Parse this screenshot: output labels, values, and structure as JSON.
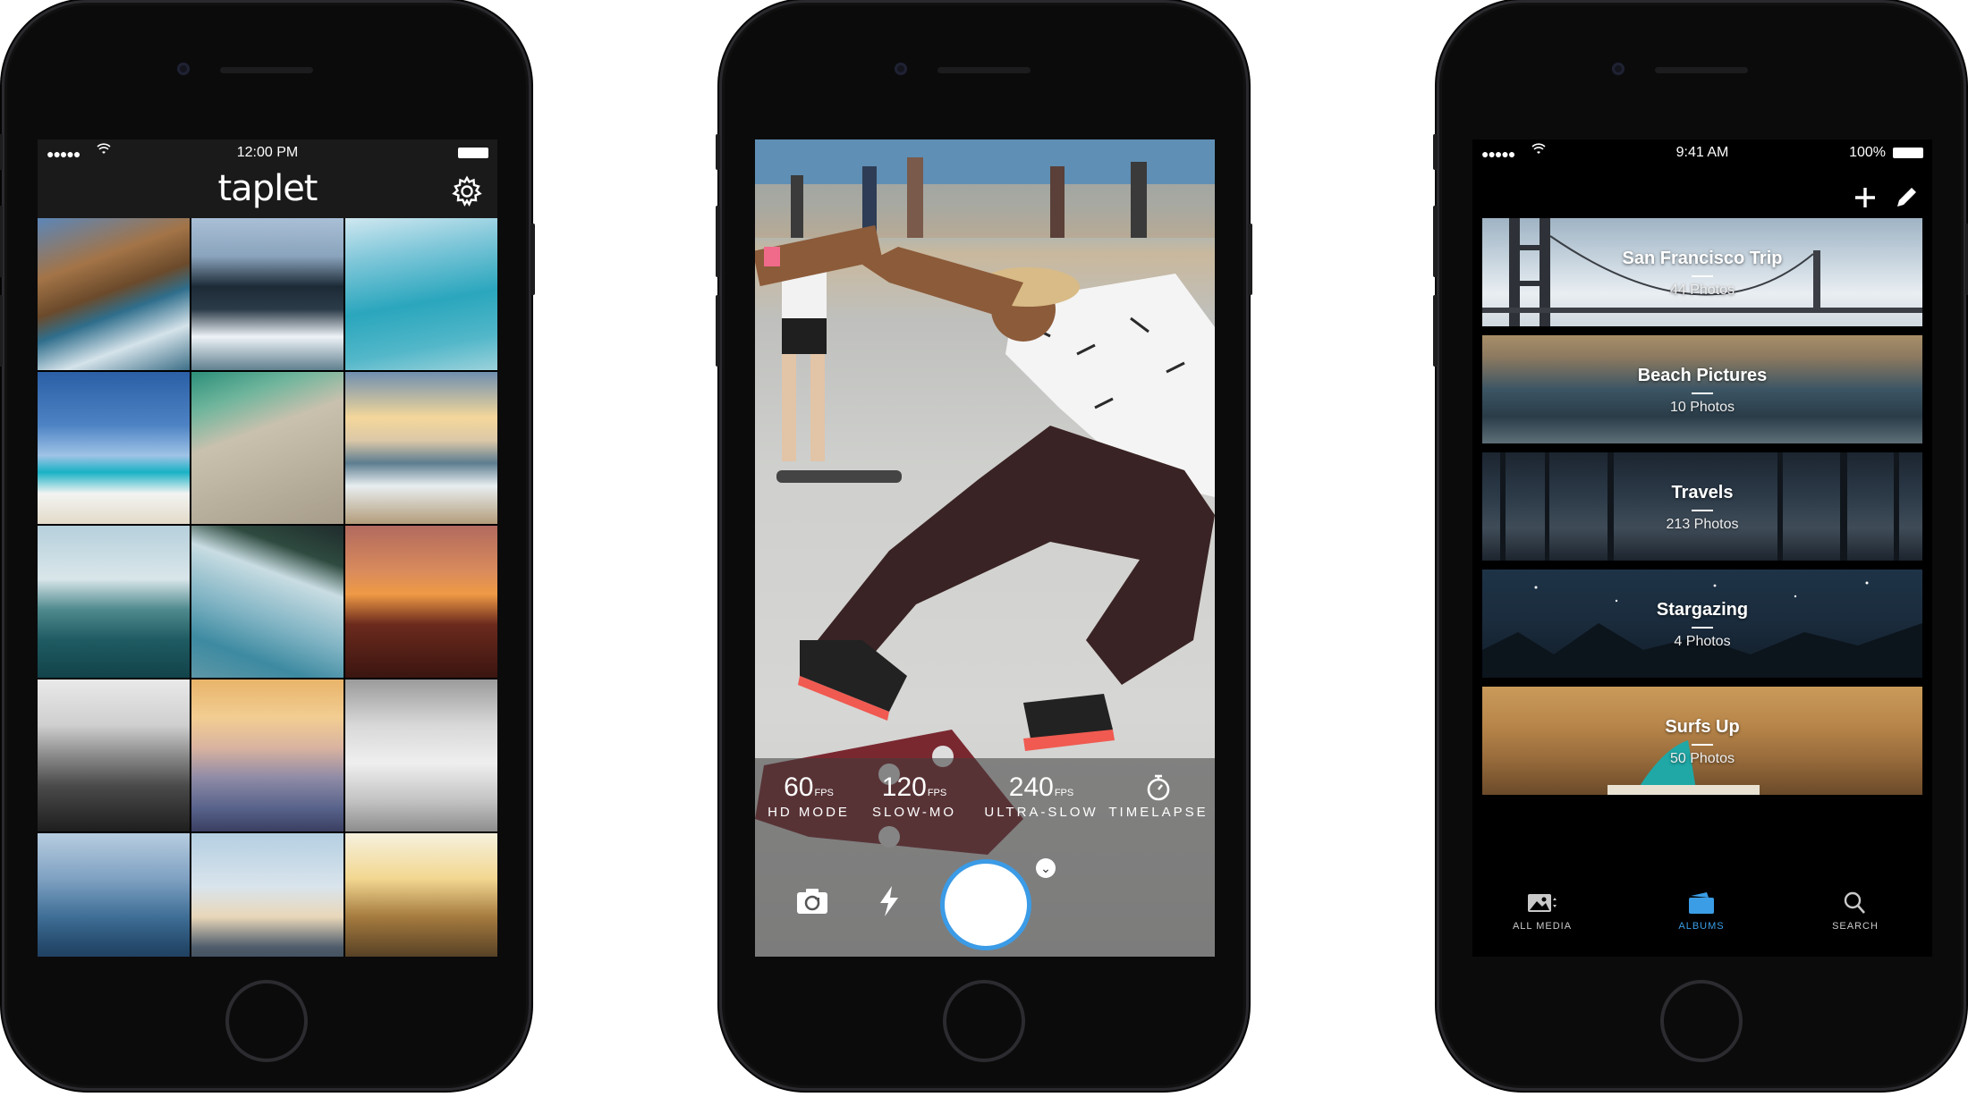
{
  "phone1": {
    "status": {
      "dots": "●●●●●",
      "time": "12:00 PM"
    },
    "app_title": "taplet",
    "settings_icon": "gear-icon",
    "photo_tiles": [
      {
        "name": "rocky-coast"
      },
      {
        "name": "wave-rock"
      },
      {
        "name": "swimmers-beach"
      },
      {
        "name": "blue-sky-shore"
      },
      {
        "name": "aerial-beach-umbrellas"
      },
      {
        "name": "sunset-waves"
      },
      {
        "name": "surfer-horizon"
      },
      {
        "name": "palm-ocean"
      },
      {
        "name": "sunset-surfer-silhouette"
      },
      {
        "name": "misty-bw-coast"
      },
      {
        "name": "pastel-sunset-beach"
      },
      {
        "name": "bw-surfer-walking"
      },
      {
        "name": "ocean-clouds"
      },
      {
        "name": "lighthouse-evening"
      },
      {
        "name": "golden-hour-surfer"
      }
    ]
  },
  "phone2": {
    "modes": [
      {
        "value": "60",
        "unit": "FPS",
        "label": "HD MODE"
      },
      {
        "value": "120",
        "unit": "FPS",
        "label": "SLOW-MO"
      },
      {
        "value": "240",
        "unit": "FPS",
        "label": "ULTRA-SLOW"
      },
      {
        "value": "",
        "unit": "",
        "label": "TIMELAPSE"
      }
    ],
    "controls": [
      "switch-camera-icon",
      "flash-icon",
      "shutter-button",
      "chevron-down-icon"
    ]
  },
  "phone3": {
    "status": {
      "dots": "●●●●●",
      "time": "9:41 AM",
      "battery": "100%"
    },
    "actions": [
      "plus-icon",
      "pencil-icon"
    ],
    "albums": [
      {
        "title": "San Francisco Trip",
        "count": "44 Photos"
      },
      {
        "title": "Beach Pictures",
        "count": "10 Photos"
      },
      {
        "title": "Travels",
        "count": "213 Photos"
      },
      {
        "title": "Stargazing",
        "count": "4 Photos"
      },
      {
        "title": "Surfs Up",
        "count": "50 Photos"
      }
    ],
    "tabs": [
      {
        "label": "ALL MEDIA",
        "icon": "media-icon",
        "active": false
      },
      {
        "label": "ALBUMS",
        "icon": "albums-icon",
        "active": true
      },
      {
        "label": "SEARCH",
        "icon": "search-icon",
        "active": false
      }
    ],
    "accent_color": "#3a9de6"
  }
}
